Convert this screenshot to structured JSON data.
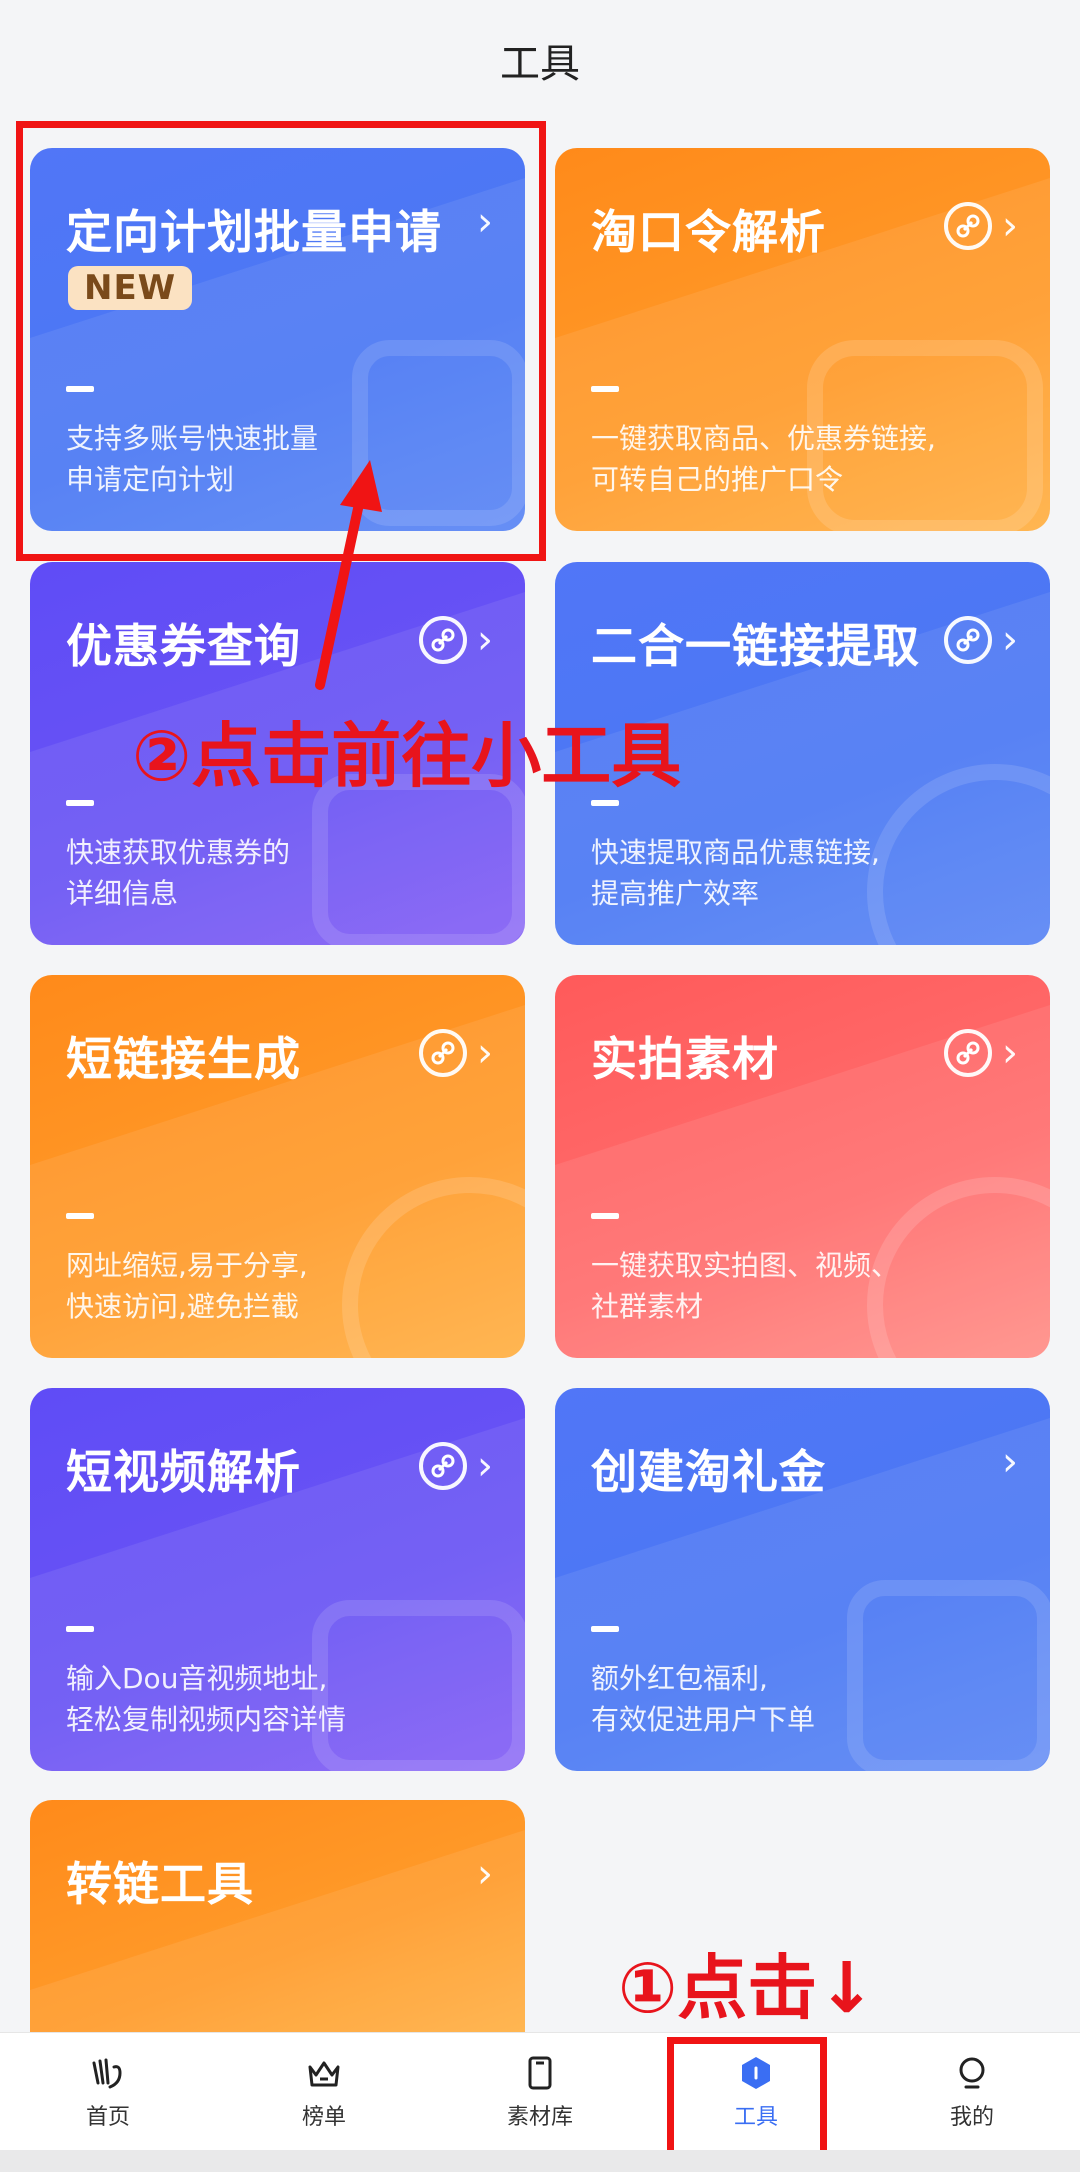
{
  "header": {
    "title": "工具"
  },
  "cards": [
    {
      "title": "定向计划批量申请",
      "badge": "NEW",
      "desc1": "支持多账号快速批量",
      "desc2": "申请定向计划"
    },
    {
      "title": "淘口令解析",
      "desc1": "一键获取商品、优惠券链接,",
      "desc2": "可转自己的推广口令"
    },
    {
      "title": "优惠券查询",
      "desc1": "快速获取优惠券的",
      "desc2": "详细信息"
    },
    {
      "title": "二合一链接提取",
      "desc1": "快速提取商品优惠链接,",
      "desc2": "提高推广效率"
    },
    {
      "title": "短链接生成",
      "desc1": "网址缩短,易于分享,",
      "desc2": "快速访问,避免拦截"
    },
    {
      "title": "实拍素材",
      "desc1": "一键获取实拍图、视频、",
      "desc2": "社群素材"
    },
    {
      "title": "短视频解析",
      "desc1": "输入Dou音视频地址,",
      "desc2": "轻松复制视频内容详情"
    },
    {
      "title": "创建淘礼金",
      "desc1": "额外红包福利,",
      "desc2": "有效促进用户下单"
    },
    {
      "title": "转链工具"
    }
  ],
  "annotations": {
    "step2": "②点击前往小工具",
    "step1": "①点击↓"
  },
  "tabbar": [
    {
      "label": "首页",
      "icon": "home-icon"
    },
    {
      "label": "榜单",
      "icon": "crown-icon"
    },
    {
      "label": "素材库",
      "icon": "phone-icon"
    },
    {
      "label": "工具",
      "icon": "shield-icon",
      "active": true
    },
    {
      "label": "我的",
      "icon": "bulb-icon"
    }
  ],
  "colors": {
    "accent": "#3a6ef3",
    "annotation": "#e8141c"
  }
}
